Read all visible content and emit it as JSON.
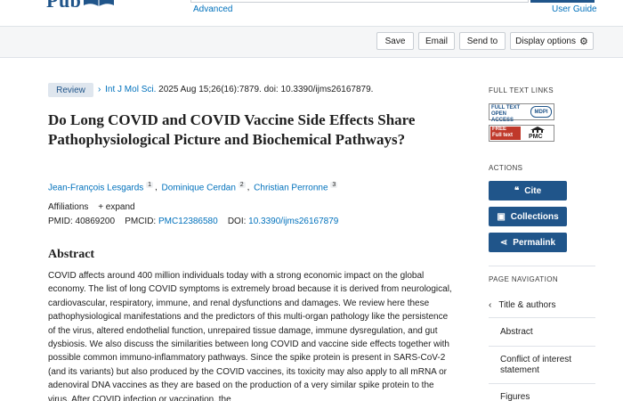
{
  "header": {
    "advanced": "Advanced",
    "user_guide": "User Guide"
  },
  "toolbar": {
    "save": "Save",
    "email": "Email",
    "send_to": "Send to",
    "display_options": "Display options"
  },
  "article": {
    "type": "Review",
    "journal": "Int J Mol Sci.",
    "citation_rest": " 2025 Aug 15;26(16):7879. doi: 10.3390/ijms26167879.",
    "title": "Do Long COVID and COVID Vaccine Side Effects Share Pathophysiological Picture and Biochemical Pathways?",
    "authors": [
      {
        "name": "Jean-François Lesgards",
        "sup": "1"
      },
      {
        "name": "Dominique Cerdan",
        "sup": "2"
      },
      {
        "name": "Christian Perronne",
        "sup": "3"
      }
    ],
    "affiliations_label": "Affiliations",
    "expand_label": "+ expand",
    "pmid_label": "PMID: 40869200",
    "pmcid_label": "PMCID:",
    "pmcid": "PMC12386580",
    "doi_label": "DOI:",
    "doi": "10.3390/ijms26167879",
    "abstract_heading": "Abstract",
    "abstract_text": "COVID affects around 400 million individuals today with a strong economic impact on the global economy. The list of long COVID symptoms is extremely broad because it is derived from neurological, cardiovascular, respiratory, immune, and renal dysfunctions and damages. We review here these pathophysiological manifestations and the predictors of this multi-organ pathology like the persistence of the virus, altered endothelial function, unrepaired tissue damage, immune dysregulation, and gut dysbiosis. We also discuss the similarities between long COVID and vaccine side effects together with possible common immuno-inflammatory pathways. Since the spike protein is present in SARS-CoV-2 (and its variants) but also produced by the COVID vaccines, its toxicity may also apply to all mRNA or adenoviral DNA vaccines as they are based on the production of a very similar spike protein to the virus. After COVID infection or vaccination, the"
  },
  "sidebar": {
    "full_text_heading": "FULL TEXT LINKS",
    "mdpi_left": "FULL TEXT OPEN ACCESS",
    "mdpi_right": "MDPI",
    "pmc_left": "FREE Full text",
    "pmc_right": "PMC",
    "actions_heading": "ACTIONS",
    "cite": "Cite",
    "collections": "Collections",
    "permalink": "Permalink",
    "page_nav_heading": "PAGE NAVIGATION",
    "nav": [
      "Title & authors",
      "Abstract",
      "Conflict of interest statement",
      "Figures"
    ]
  },
  "colors": {
    "brand": "#20558a",
    "link": "#0071bc",
    "free_badge": "#c0392b"
  }
}
